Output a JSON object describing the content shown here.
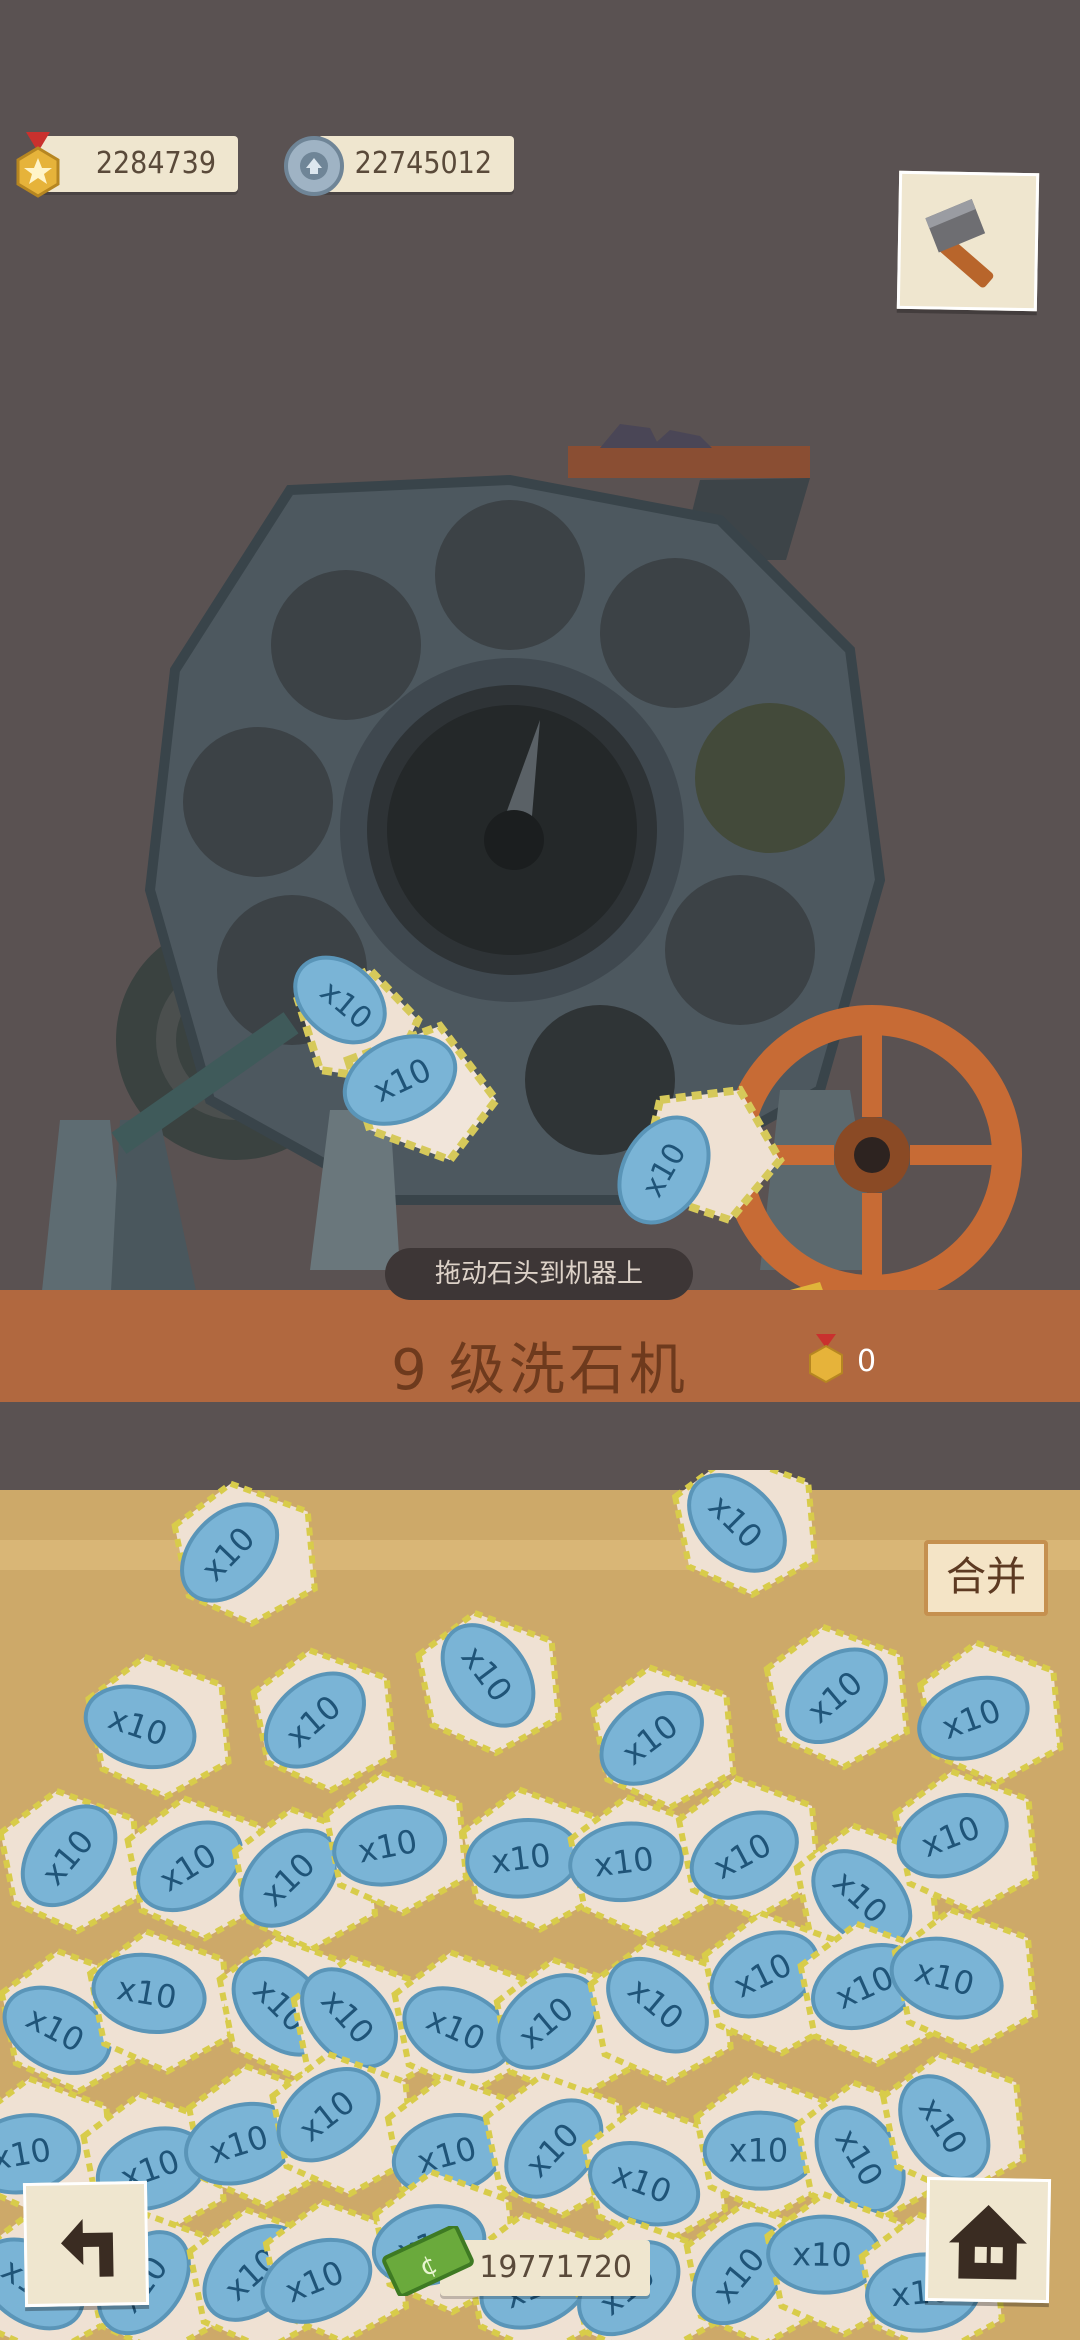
{
  "resources": {
    "medals": "2284739",
    "gears": "22745012"
  },
  "machine": {
    "hint": "拖动石头到机器上",
    "level_number": "9",
    "level_title": "级洗石机",
    "medal_count": "0",
    "stone_label": "x10"
  },
  "pile": {
    "merge_label": "合并",
    "stone_label": "x10"
  },
  "bottom_bar": {
    "cash": "19771720"
  },
  "colors": {
    "background": "#5a5252",
    "machine_body": "#4a5259",
    "wheel": "#c76b35",
    "stone_tag": "#7ab4d6",
    "stone": "#efe1d3",
    "box": "#cda969"
  },
  "icons": {
    "medal": "medal-icon",
    "gear": "gear-icon",
    "tool": "hammer-icon",
    "back": "back-arrow-icon",
    "home": "house-icon",
    "cash": "cash-icon"
  }
}
